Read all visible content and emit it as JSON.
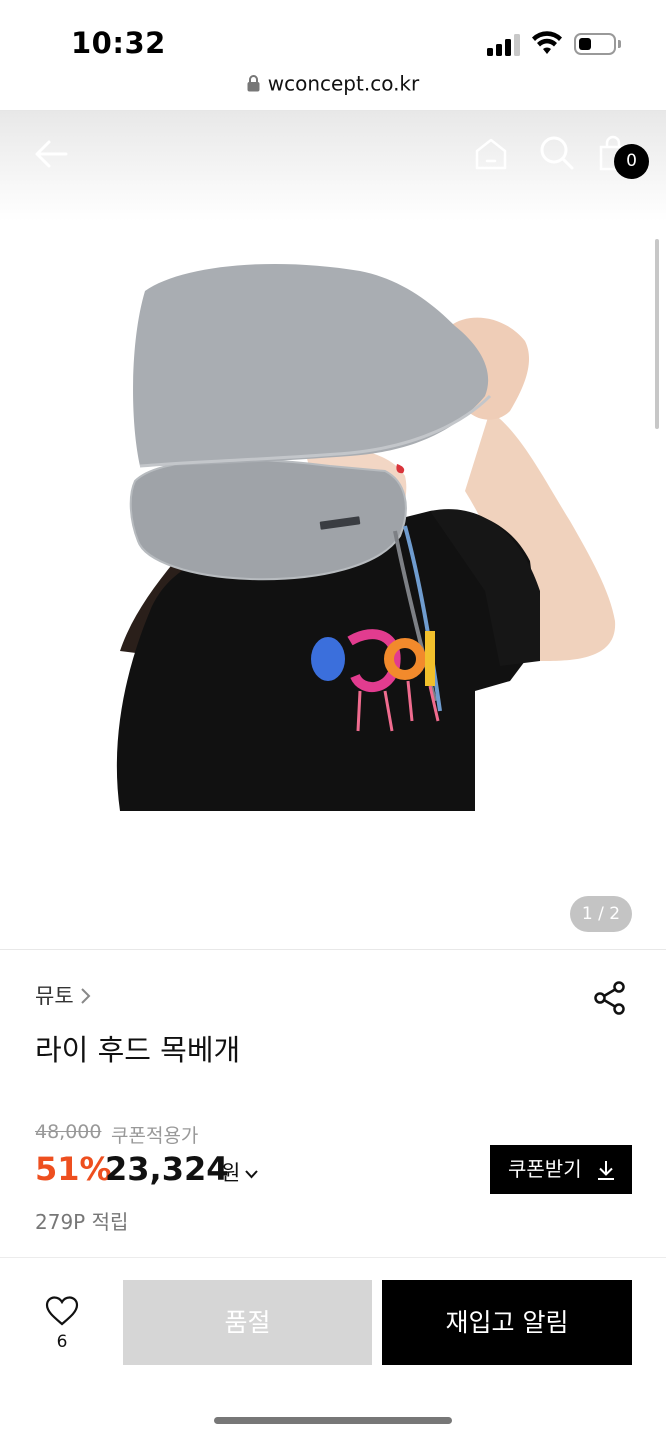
{
  "status_bar": {
    "time": "10:32",
    "url": "wconcept.co.kr",
    "icons": [
      "signal-icon",
      "wifi-icon",
      "battery-icon",
      "lock-icon"
    ]
  },
  "header": {
    "icons": [
      "back-arrow-icon",
      "home-icon",
      "search-icon",
      "shopping-bag-icon"
    ],
    "cart_count": "0"
  },
  "gallery": {
    "image_description": "gray hooded neck pillow worn by person in black t-shirt",
    "counter": "1 / 2"
  },
  "product": {
    "brand": "뮤토",
    "name": "라이 후드 목베개",
    "original_price": "48,000",
    "coupon_price_label": "쿠폰적용가",
    "discount_rate": "51%",
    "sale_price": "23,324",
    "currency": "원",
    "points": "279P 적립",
    "coupon_button": "쿠폰받기"
  },
  "bottom_bar": {
    "wish_count": "6",
    "soldout_label": "품절",
    "restock_label": "재입고 알림"
  },
  "colors": {
    "accent_discount": "#ee4f1f",
    "primary_button": "#000000",
    "disabled_button": "#d6d6d6"
  }
}
